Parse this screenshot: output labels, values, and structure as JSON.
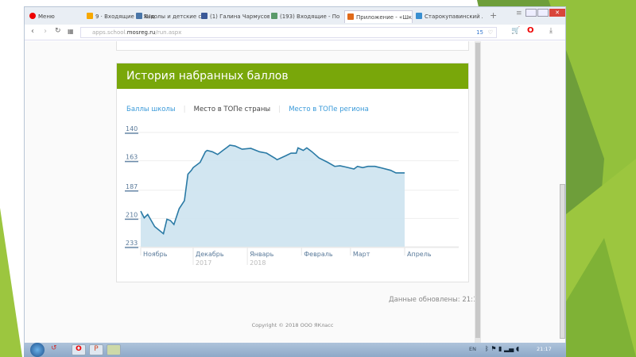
{
  "browser": {
    "menu_label": "Меню",
    "tabs": [
      {
        "label": "9 · Входящие — Яндек",
        "icon": "mail-icon",
        "color": "#f7a800"
      },
      {
        "label": "Школы и детские сады",
        "icon": "vk-icon",
        "color": "#4a76a8"
      },
      {
        "label": "(1) Галина Чармусова",
        "icon": "facebook-icon",
        "color": "#3b5998"
      },
      {
        "label": "(193) Входящие - Почт",
        "icon": "mail-icon",
        "color": "#5a9a6a"
      },
      {
        "label": "Приложение - «Школ",
        "icon": "app-icon",
        "color": "#e06a1a",
        "active": true
      },
      {
        "label": "Старокупавинский ли",
        "icon": "site-icon",
        "color": "#3a8fd0"
      }
    ],
    "url_prefix": "apps.school.",
    "url_domain": "mosreg.ru",
    "url_path": "/run.aspx",
    "badge_count": "15"
  },
  "card": {
    "title": "История набранных баллов",
    "tabs": [
      {
        "label": "Баллы школы",
        "active": false
      },
      {
        "label": "Место в ТОПе страны",
        "active": true
      },
      {
        "label": "Место в ТОПе региона",
        "active": false
      }
    ]
  },
  "updated": "Данные обновлены: 21:12",
  "copyright": "Copyright © 2018 ООО ЯКласс",
  "taskbar": {
    "lang": "EN",
    "time": "21:17"
  },
  "colors": {
    "accent_green": "#79a70a",
    "line": "#2a7aa5",
    "fill": "#cde3ef",
    "link": "#3a9ad9"
  },
  "chart_data": {
    "type": "area",
    "y_inverted": true,
    "ylim": [
      233,
      140
    ],
    "yticks": [
      "140",
      "163",
      "187",
      "210",
      "233"
    ],
    "xticks": [
      {
        "label": "Ноябрь",
        "date": "2017-11-01"
      },
      {
        "label": "Декабрь",
        "sub": "2017",
        "date": "2017-12-01"
      },
      {
        "label": "Январь",
        "sub": "2018",
        "date": "2018-01-01"
      },
      {
        "label": "Февраль",
        "date": "2018-02-01"
      },
      {
        "label": "Март",
        "date": "2018-03-01"
      },
      {
        "label": "Апрель",
        "date": "2018-04-01"
      }
    ],
    "grid": true,
    "points": [
      [
        "2017-11-01",
        204
      ],
      [
        "2017-11-03",
        209.5
      ],
      [
        "2017-11-05",
        206.7
      ],
      [
        "2017-11-09",
        216.6
      ],
      [
        "2017-11-14",
        222.4
      ],
      [
        "2017-11-16",
        210.6
      ],
      [
        "2017-11-18",
        211.7
      ],
      [
        "2017-11-20",
        214.9
      ],
      [
        "2017-11-23",
        202
      ],
      [
        "2017-11-26",
        195.5
      ],
      [
        "2017-11-28",
        174
      ],
      [
        "2017-11-30",
        170.8
      ],
      [
        "2017-12-01",
        168.6
      ],
      [
        "2017-12-05",
        164.3
      ],
      [
        "2017-12-08",
        155.7
      ],
      [
        "2017-12-09",
        154.6
      ],
      [
        "2017-12-12",
        155.7
      ],
      [
        "2017-12-15",
        157.9
      ],
      [
        "2017-12-18",
        154.6
      ],
      [
        "2017-12-20",
        152.5
      ],
      [
        "2017-12-22",
        150.3
      ],
      [
        "2017-12-25",
        151
      ],
      [
        "2017-12-29",
        153.6
      ],
      [
        "2018-01-03",
        152.9
      ],
      [
        "2018-01-08",
        155.7
      ],
      [
        "2018-01-12",
        156.8
      ],
      [
        "2018-01-17",
        161.1
      ],
      [
        "2018-01-18",
        162.2
      ],
      [
        "2018-01-23",
        158.9
      ],
      [
        "2018-01-26",
        156.8
      ],
      [
        "2018-01-29",
        156.8
      ],
      [
        "2018-01-30",
        152.5
      ],
      [
        "2018-02-02",
        154.6
      ],
      [
        "2018-02-04",
        152.5
      ],
      [
        "2018-02-07",
        155.7
      ],
      [
        "2018-02-11",
        160.7
      ],
      [
        "2018-02-16",
        164.3
      ],
      [
        "2018-02-20",
        167.6
      ],
      [
        "2018-02-23",
        167.1
      ],
      [
        "2018-02-26",
        168
      ],
      [
        "2018-03-03",
        169.7
      ],
      [
        "2018-03-05",
        167.6
      ],
      [
        "2018-03-08",
        168.6
      ],
      [
        "2018-03-11",
        167.6
      ],
      [
        "2018-03-15",
        167.6
      ],
      [
        "2018-03-18",
        168.6
      ],
      [
        "2018-03-24",
        170.8
      ],
      [
        "2018-03-27",
        172.9
      ],
      [
        "2018-04-01",
        172.9
      ]
    ]
  }
}
